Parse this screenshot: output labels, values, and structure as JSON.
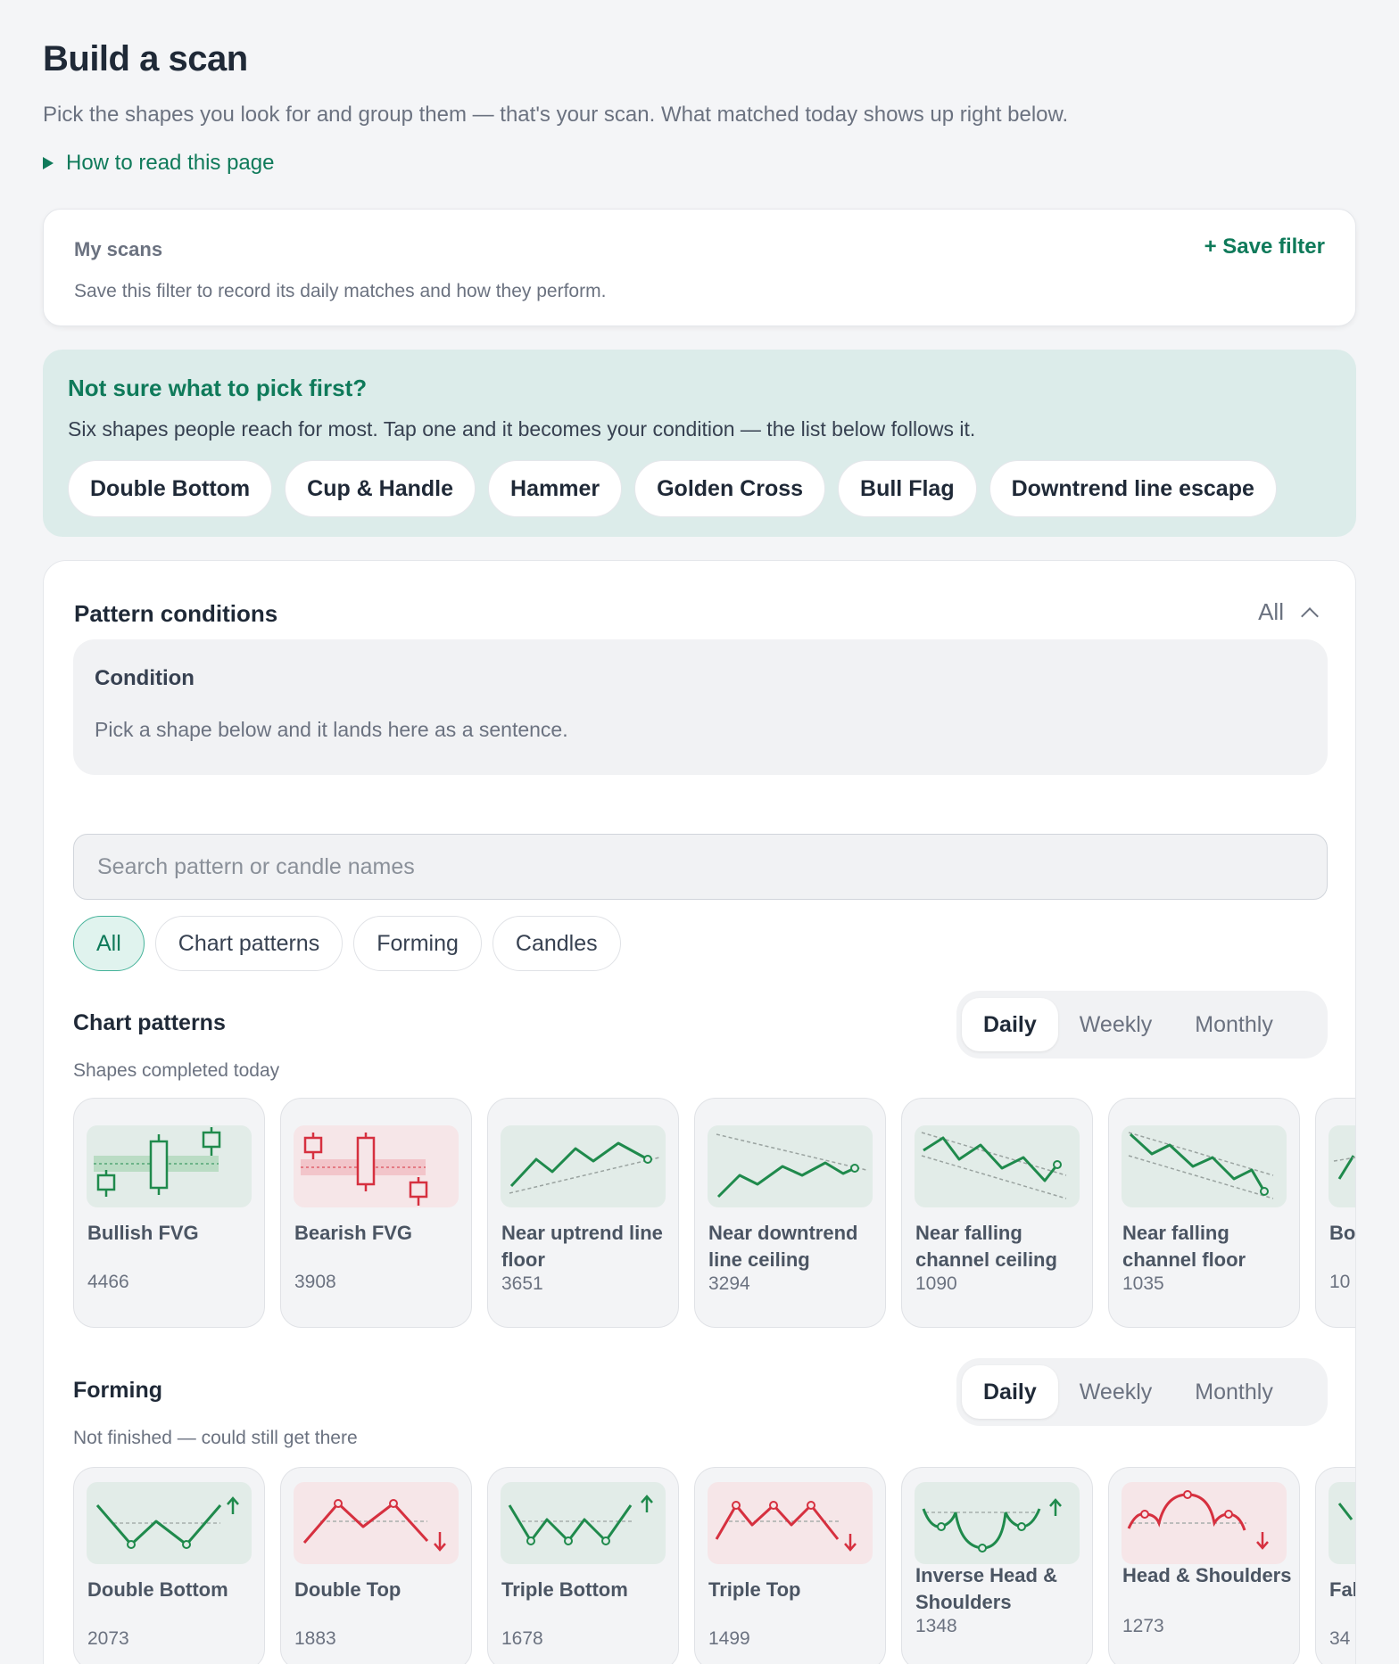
{
  "header": {
    "title": "Build a scan",
    "subtitle": "Pick the shapes you look for and group them — that's your scan. What matched today shows up right below.",
    "howto": "How to read this page"
  },
  "my_scans": {
    "title": "My scans",
    "description": "Save this filter to record its daily matches and how they perform.",
    "save_label": "+ Save filter"
  },
  "suggest": {
    "title": "Not sure what to pick first?",
    "description": "Six shapes people reach for most. Tap one and it becomes your condition — the list below follows it.",
    "chips": [
      "Double Bottom",
      "Cup & Handle",
      "Hammer",
      "Golden Cross",
      "Bull Flag",
      "Downtrend line escape"
    ]
  },
  "pattern_conditions": {
    "title": "Pattern conditions",
    "mode": "All",
    "condition_title": "Condition",
    "condition_desc": "Pick a shape below and it lands here as a sentence.",
    "search_placeholder": "Search pattern or candle names",
    "filters": [
      "All",
      "Chart patterns",
      "Forming",
      "Candles"
    ],
    "active_filter": "All",
    "timeframes": [
      "Daily",
      "Weekly",
      "Monthly"
    ],
    "active_timeframe": "Daily"
  },
  "chart_patterns": {
    "title": "Chart patterns",
    "subtitle": "Shapes completed today",
    "tiles": [
      {
        "name": "Bullish FVG",
        "count": "4466",
        "icon": "bullish-fvg-icon",
        "tone": "green"
      },
      {
        "name": "Bearish FVG",
        "count": "3908",
        "icon": "bearish-fvg-icon",
        "tone": "red"
      },
      {
        "name": "Near uptrend line floor",
        "count": "3651",
        "icon": "uptrend-floor-icon",
        "tone": "green"
      },
      {
        "name": "Near downtrend line ceiling",
        "count": "3294",
        "icon": "downtrend-ceiling-icon",
        "tone": "green"
      },
      {
        "name": "Near falling channel ceiling",
        "count": "1090",
        "icon": "falling-channel-ceiling-icon",
        "tone": "green"
      },
      {
        "name": "Near falling channel floor",
        "count": "1035",
        "icon": "falling-channel-floor-icon",
        "tone": "green"
      },
      {
        "name": "Bo",
        "count": "10",
        "icon": "partial-pattern-icon",
        "tone": "green"
      }
    ]
  },
  "forming": {
    "title": "Forming",
    "subtitle": "Not finished — could still get there",
    "tiles": [
      {
        "name": "Double Bottom",
        "count": "2073",
        "icon": "double-bottom-icon",
        "tone": "green"
      },
      {
        "name": "Double Top",
        "count": "1883",
        "icon": "double-top-icon",
        "tone": "red"
      },
      {
        "name": "Triple Bottom",
        "count": "1678",
        "icon": "triple-bottom-icon",
        "tone": "green"
      },
      {
        "name": "Triple Top",
        "count": "1499",
        "icon": "triple-top-icon",
        "tone": "red"
      },
      {
        "name": "Inverse Head & Shoulders",
        "count": "1348",
        "icon": "inverse-head-shoulders-icon",
        "tone": "green"
      },
      {
        "name": "Head & Shoulders",
        "count": "1273",
        "icon": "head-shoulders-icon",
        "tone": "red"
      },
      {
        "name": "Fal",
        "count": "34",
        "icon": "partial-pattern-icon",
        "tone": "green"
      }
    ]
  },
  "colors": {
    "accent": "#0f7a5a",
    "bull": "#1f8a4c",
    "bear": "#d6303f",
    "page_bg": "#f4f5f7"
  }
}
